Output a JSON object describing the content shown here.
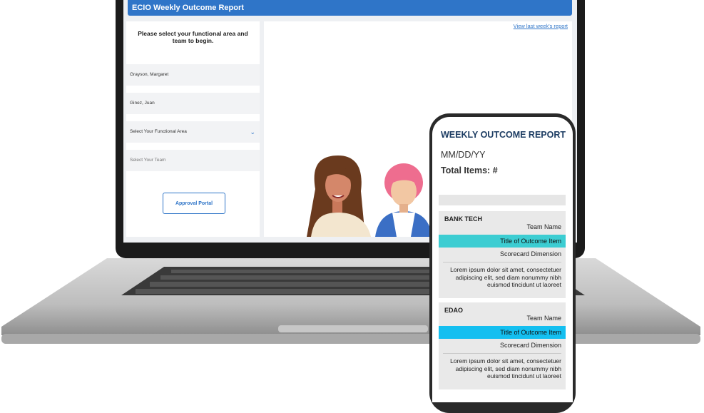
{
  "desktop": {
    "header_title": "ECIO Weekly Outcome Report",
    "prompt": "Please select your functional area and team to begin.",
    "view_last_week_link": "View last week's report",
    "person_1": "Grayson, Margaret",
    "person_2": "Ginez, Juan",
    "functional_area_placeholder": "Select Your Functional Area",
    "team_placeholder": "Select Your Team",
    "approval_button": "Approval Portal",
    "accent_color": "#2f75c8"
  },
  "mobile": {
    "title": "WEEKLY OUTCOME REPORT",
    "date": "MM/DD/YY",
    "total_items": "Total Items: #",
    "cards": [
      {
        "name": "BANK TECH",
        "team": "Team Name",
        "outcome_title": "Title of Outcome Item",
        "bar_color": "#3ccdd2",
        "dimension": "Scorecard Dimension",
        "body": "Lorem ipsum dolor sit amet, consectetuer adipiscing elit, sed diam nonummy nibh euismod tincidunt ut laoreet"
      },
      {
        "name": "EDAO",
        "team": "Team Name",
        "outcome_title": "Title of Outcome Item",
        "bar_color": "#14bff0",
        "dimension": "Scorecard Dimension",
        "body": "Lorem ipsum dolor sit amet, consectetuer adipiscing elit, sed diam nonummy nibh euismod tincidunt ut laoreet"
      }
    ]
  }
}
